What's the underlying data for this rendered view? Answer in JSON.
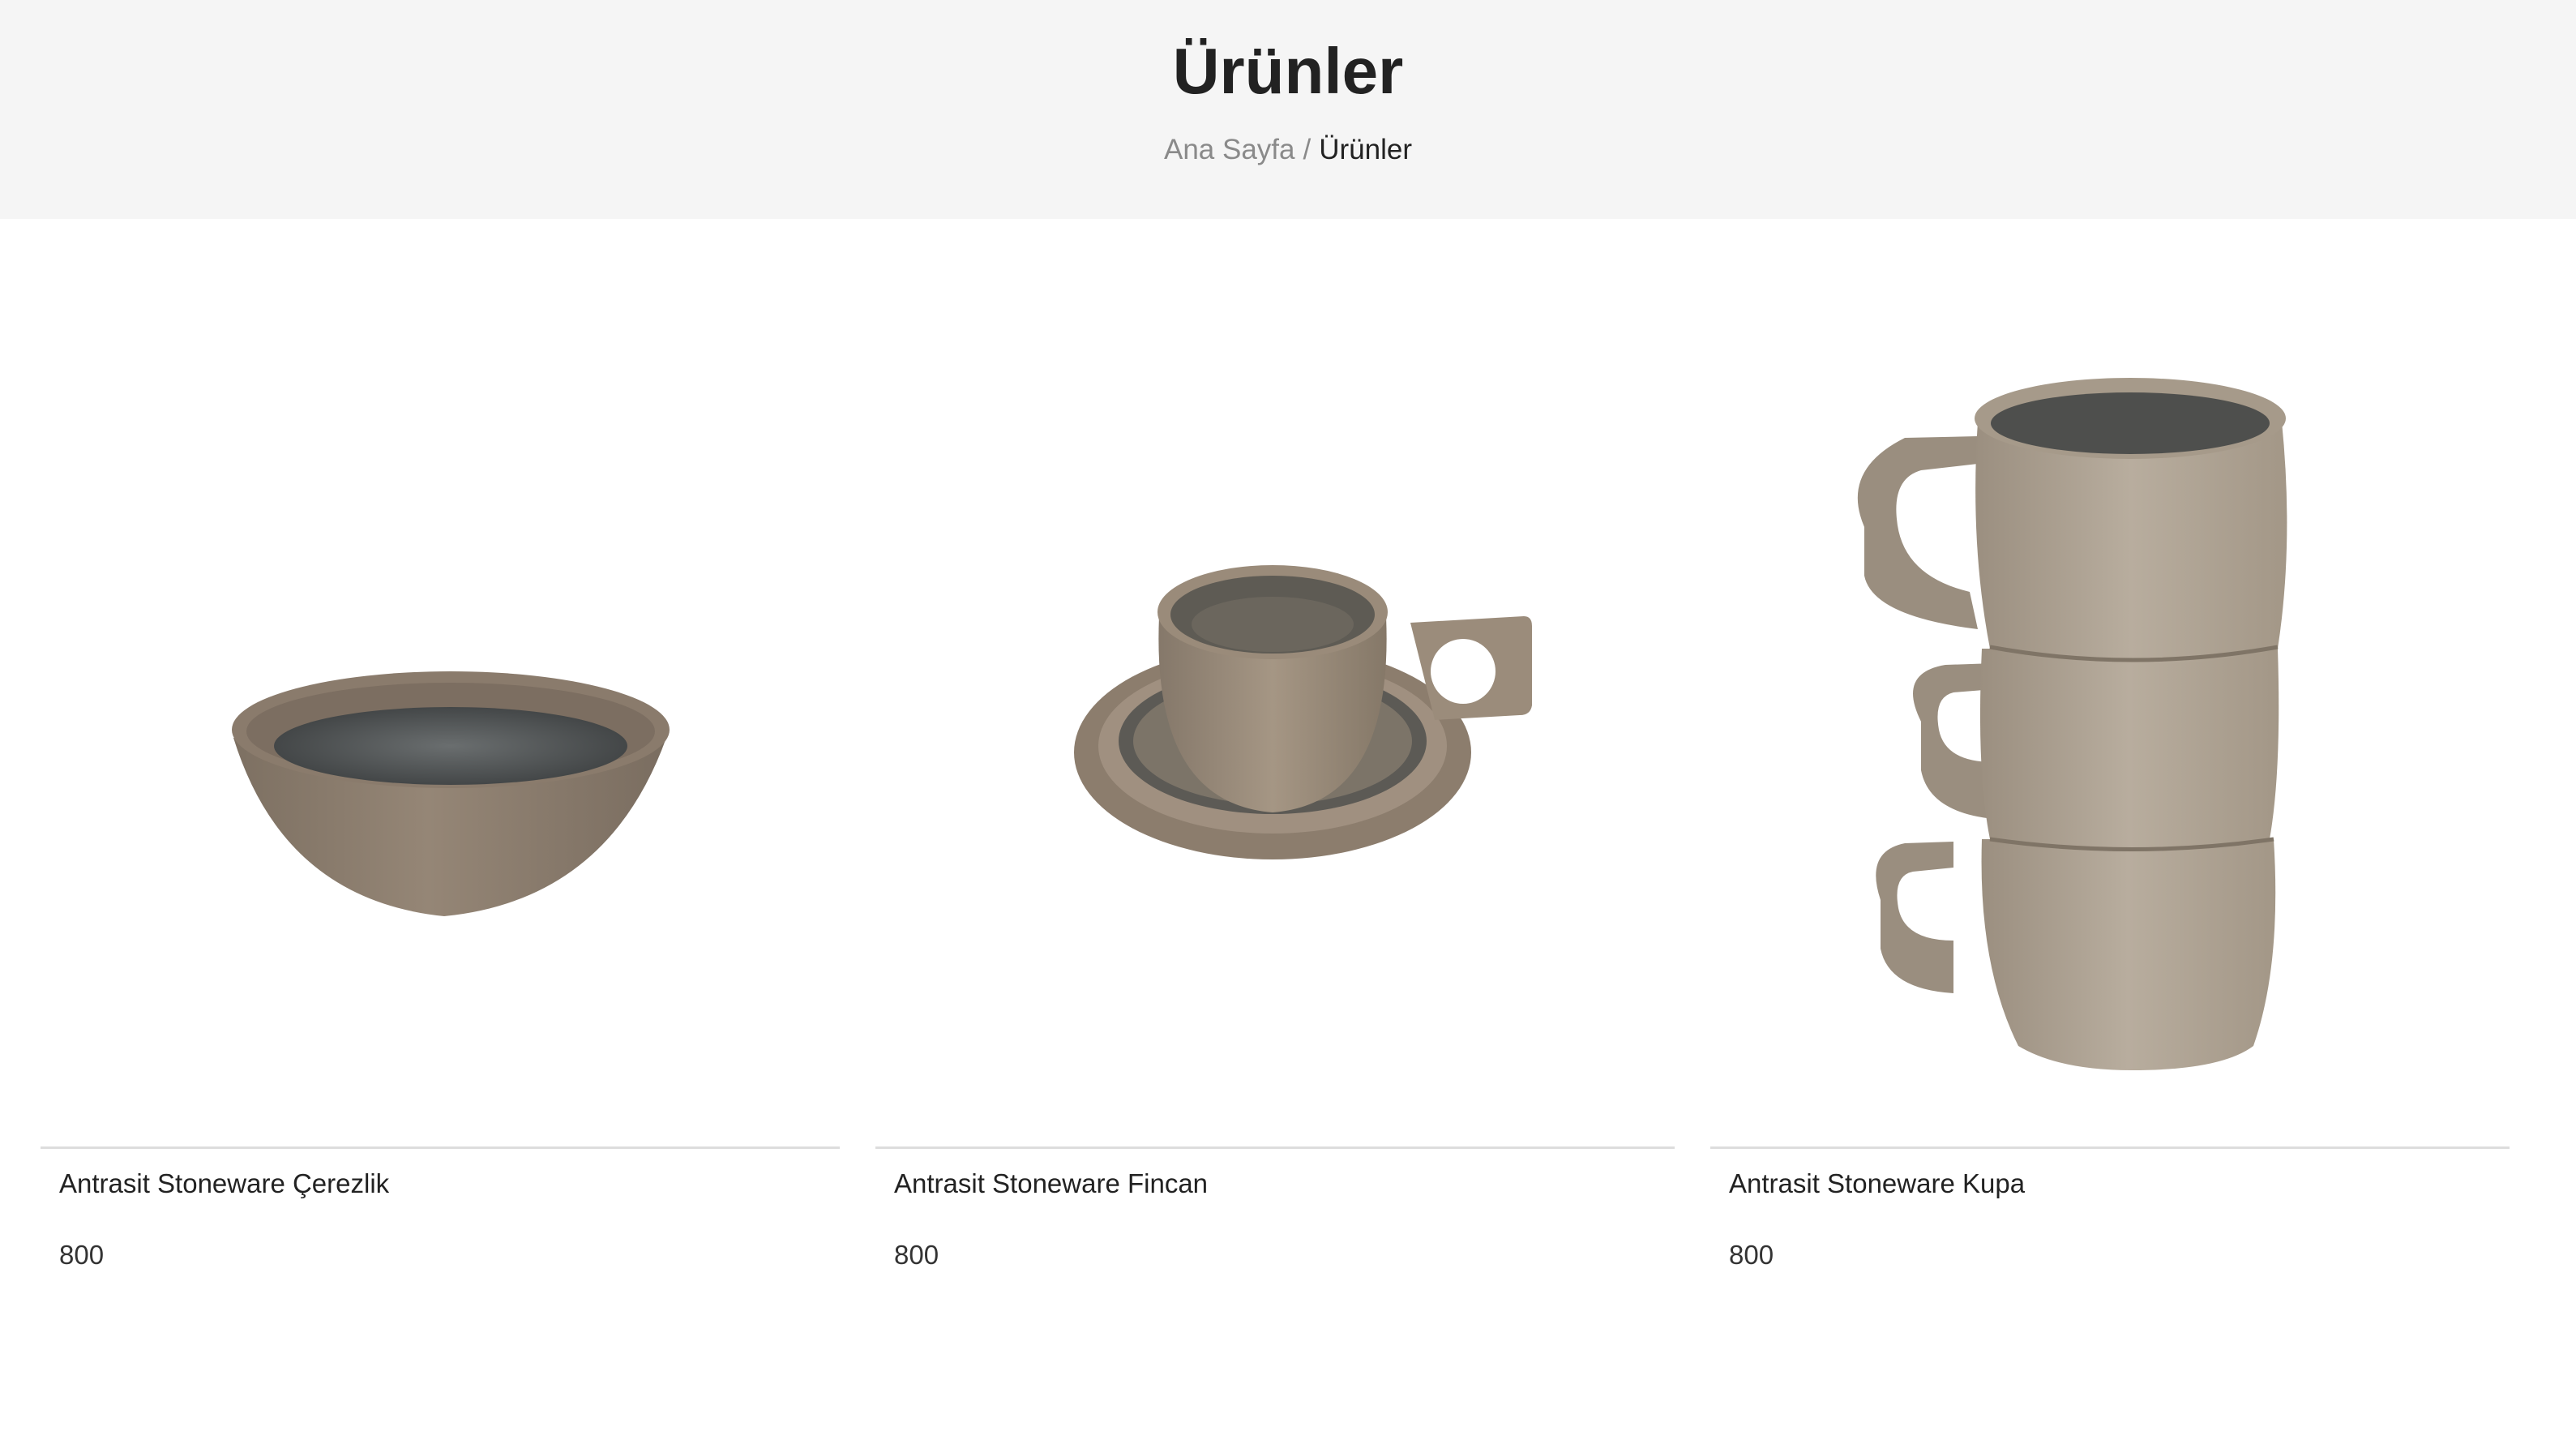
{
  "header": {
    "title": "Ürünler",
    "breadcrumb": {
      "home": "Ana Sayfa",
      "separator": "/",
      "current": "Ürünler"
    }
  },
  "products": [
    {
      "name": "Antrasit Stoneware Çerezlik",
      "price": "800",
      "image": "stoneware-bowl"
    },
    {
      "name": "Antrasit Stoneware Fincan",
      "price": "800",
      "image": "stoneware-cup-and-saucer"
    },
    {
      "name": "Antrasit Stoneware Kupa",
      "price": "800",
      "image": "stacked-stoneware-mugs"
    }
  ],
  "colors": {
    "header_bg": "#f5f5f5",
    "clay": "#8f8070",
    "glaze": "#4a4e4f",
    "divider": "#dddddd"
  }
}
